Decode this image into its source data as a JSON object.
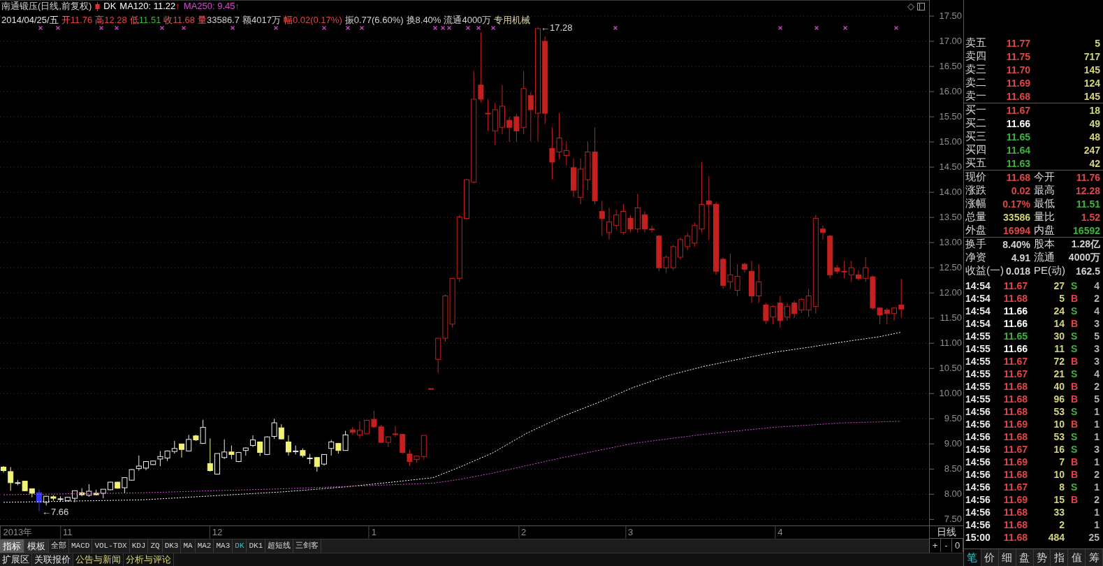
{
  "chart_header": {
    "title": "南通锻压(日线,前复权)",
    "indicator": "DK",
    "averages": [
      {
        "label": "MA120: 11.22",
        "arrow": "↑",
        "color": "#ffffff"
      },
      {
        "label": "MA250: 9.45",
        "arrow": "↑",
        "color": "#d24ad2"
      }
    ],
    "date": "2014/04/25/五",
    "fields": [
      {
        "label": {
          "text": "开",
          "kind": "up"
        },
        "value": {
          "text": "11.76",
          "kind": "up"
        }
      },
      {
        "label": {
          "text": "高",
          "kind": "up"
        },
        "value": {
          "text": "12.28",
          "kind": "up"
        }
      },
      {
        "label": {
          "text": "低",
          "kind": "up"
        },
        "value": {
          "text": "11.51",
          "kind": "down"
        }
      },
      {
        "label": {
          "text": "收",
          "kind": "up"
        },
        "value": {
          "text": "11.68",
          "kind": "up"
        }
      },
      {
        "label": {
          "text": "量",
          "kind": "up"
        },
        "value": {
          "text": "33586.7",
          "kind": "plain"
        }
      },
      {
        "label": {
          "text": "额",
          "kind": "plain"
        },
        "value": {
          "text": "4017万",
          "kind": "plain"
        }
      },
      {
        "label": {
          "text": "幅",
          "kind": "up"
        },
        "value": {
          "text": "0.02(0.17%)",
          "kind": "up"
        }
      },
      {
        "label": {
          "text": "振",
          "kind": "plain"
        },
        "value": {
          "text": "0.77(6.60%)",
          "kind": "plain"
        }
      },
      {
        "label": {
          "text": "换",
          "kind": "plain"
        },
        "value": {
          "text": "8.40%",
          "kind": "plain"
        }
      },
      {
        "label": {
          "text": "流通",
          "kind": "plain"
        },
        "value": {
          "text": "4000万",
          "kind": "plain"
        }
      }
    ],
    "sector": "专用机械"
  },
  "chart": {
    "chart_data": {
      "type": "candlestick",
      "categories": [
        null,
        null,
        "2013年",
        null,
        null,
        null,
        null,
        null,
        null,
        "11",
        null,
        null,
        null,
        null,
        null,
        null,
        null,
        null,
        null,
        null,
        null,
        null,
        null,
        null,
        null,
        null,
        null,
        null,
        null,
        null,
        "12",
        null,
        null,
        null,
        null,
        null,
        null,
        null,
        null,
        null,
        null,
        null,
        null,
        null,
        null,
        null,
        null,
        null,
        null,
        null,
        null,
        null,
        "1",
        null,
        null,
        null,
        null,
        null,
        null,
        null,
        null,
        null,
        null,
        null,
        null,
        null,
        null,
        null,
        null,
        null,
        null,
        null,
        null,
        "2",
        null,
        null,
        null,
        null,
        null,
        null,
        null,
        null,
        null,
        null,
        null,
        null,
        null,
        null,
        "3",
        null,
        null,
        null,
        null,
        null,
        null,
        null,
        null,
        null,
        null,
        null,
        null,
        null,
        null,
        null,
        null,
        null,
        null,
        null,
        null,
        "4",
        null,
        null,
        null,
        null,
        null,
        null,
        null,
        null,
        null,
        null,
        null,
        null,
        null,
        null,
        null,
        null,
        null
      ],
      "ohlc": [
        [
          8.54,
          8.56,
          8.43,
          8.47
        ],
        [
          8.45,
          8.54,
          8.07,
          8.23
        ],
        [
          8.22,
          8.28,
          8.18,
          8.23
        ],
        [
          8.26,
          8.27,
          8.06,
          8.07
        ],
        [
          8.11,
          8.11,
          7.94,
          8.02
        ],
        [
          8.03,
          8.09,
          7.66,
          7.84
        ],
        [
          7.84,
          7.97,
          7.78,
          7.96
        ],
        [
          7.95,
          7.98,
          7.87,
          7.92
        ],
        [
          7.9,
          7.96,
          7.85,
          7.91
        ],
        [
          7.87,
          7.95,
          7.86,
          7.94
        ],
        [
          7.92,
          8.07,
          7.84,
          8.07
        ],
        [
          8.03,
          8.12,
          7.96,
          7.99
        ],
        [
          7.98,
          8.2,
          7.95,
          8.06
        ],
        [
          8.02,
          8.09,
          7.98,
          7.99
        ],
        [
          8.02,
          8.1,
          7.92,
          8.1
        ],
        [
          8.09,
          8.25,
          8.08,
          8.24
        ],
        [
          8.24,
          8.25,
          8.11,
          8.12
        ],
        [
          8.13,
          8.33,
          8.02,
          8.33
        ],
        [
          8.28,
          8.5,
          8.27,
          8.49
        ],
        [
          8.51,
          8.77,
          8.47,
          8.56
        ],
        [
          8.52,
          8.65,
          8.48,
          8.65
        ],
        [
          8.59,
          8.67,
          8.58,
          8.66
        ],
        [
          8.7,
          8.86,
          8.56,
          8.75
        ],
        [
          8.72,
          8.87,
          8.66,
          8.86
        ],
        [
          8.85,
          9.06,
          8.81,
          8.91
        ],
        [
          9.0,
          9.0,
          8.73,
          8.89
        ],
        [
          8.86,
          9.18,
          8.85,
          9.09
        ],
        [
          9.16,
          9.18,
          9.06,
          9.08
        ],
        [
          9.01,
          9.48,
          9.01,
          9.33
        ],
        [
          8.61,
          9.11,
          8.45,
          8.47
        ],
        [
          8.4,
          8.81,
          8.4,
          8.81
        ],
        [
          8.73,
          9.09,
          8.7,
          8.84
        ],
        [
          8.84,
          8.97,
          8.7,
          8.79
        ],
        [
          8.65,
          8.84,
          8.64,
          8.83
        ],
        [
          8.87,
          8.93,
          8.77,
          8.92
        ],
        [
          8.97,
          9.17,
          8.94,
          9.08
        ],
        [
          9.04,
          9.05,
          8.76,
          8.83
        ],
        [
          8.79,
          9.15,
          8.78,
          9.14
        ],
        [
          9.15,
          9.5,
          9.1,
          9.42
        ],
        [
          9.32,
          9.39,
          9.09,
          9.1
        ],
        [
          9.04,
          9.17,
          8.77,
          8.84
        ],
        [
          8.85,
          8.97,
          8.79,
          8.86
        ],
        [
          8.87,
          8.91,
          8.73,
          8.77
        ],
        [
          8.71,
          8.8,
          8.6,
          8.72
        ],
        [
          8.73,
          8.74,
          8.45,
          8.55
        ],
        [
          8.6,
          8.79,
          8.57,
          8.79
        ],
        [
          8.91,
          9.08,
          8.77,
          9.04
        ],
        [
          9.01,
          9.02,
          8.81,
          8.87
        ],
        [
          8.87,
          9.26,
          8.87,
          9.18
        ],
        [
          9.28,
          9.34,
          9.18,
          9.23
        ],
        [
          9.18,
          9.45,
          9.11,
          9.27
        ],
        [
          9.2,
          9.48,
          9.19,
          9.47
        ],
        [
          9.49,
          9.66,
          9.32,
          9.34
        ],
        [
          9.34,
          9.38,
          9.02,
          9.03
        ],
        [
          9.03,
          9.15,
          8.94,
          9.14
        ],
        [
          9.2,
          9.36,
          9.14,
          9.19
        ],
        [
          9.19,
          9.2,
          8.8,
          8.83
        ],
        [
          8.8,
          8.89,
          8.56,
          8.65
        ],
        [
          8.69,
          8.77,
          8.63,
          8.76
        ],
        [
          8.75,
          9.17,
          8.69,
          9.17
        ],
        [
          10.1,
          10.1,
          10.1,
          10.1
        ],
        [
          10.68,
          11.1,
          10.41,
          11.1
        ],
        [
          11.1,
          11.97,
          11.03,
          11.94
        ],
        [
          11.38,
          12.29,
          11.31,
          12.29
        ],
        [
          12.29,
          13.55,
          12.22,
          13.51
        ],
        [
          13.48,
          14.27,
          13.45,
          14.25
        ],
        [
          14.2,
          16.41,
          14.18,
          15.85
        ],
        [
          16.13,
          17.18,
          15.78,
          15.85
        ],
        [
          15.57,
          15.85,
          15.22,
          15.57
        ],
        [
          15.22,
          15.78,
          14.94,
          15.64
        ],
        [
          15.29,
          16.13,
          15.15,
          15.71
        ],
        [
          15.43,
          15.5,
          15.0,
          15.29
        ],
        [
          15.5,
          15.55,
          15.0,
          15.22
        ],
        [
          15.29,
          16.41,
          15.15,
          16.06
        ],
        [
          15.92,
          15.99,
          15.01,
          15.64
        ],
        [
          15.57,
          17.28,
          15.01,
          17.25
        ],
        [
          17.0,
          17.1,
          15.36,
          15.57
        ],
        [
          14.87,
          15.29,
          14.25,
          14.6
        ],
        [
          14.8,
          15.57,
          14.66,
          15.08
        ],
        [
          14.73,
          15.01,
          14.53,
          14.83
        ],
        [
          14.49,
          14.67,
          13.9,
          14.04
        ],
        [
          13.9,
          14.67,
          13.76,
          14.46
        ],
        [
          14.25,
          15.01,
          14.04,
          14.8
        ],
        [
          14.8,
          15.29,
          13.76,
          13.83
        ],
        [
          13.62,
          13.83,
          13.13,
          13.48
        ],
        [
          13.2,
          13.69,
          13.06,
          13.41
        ],
        [
          13.34,
          13.65,
          13.27,
          13.55
        ],
        [
          13.2,
          13.76,
          13.15,
          13.62
        ],
        [
          13.48,
          13.55,
          13.2,
          13.27
        ],
        [
          13.27,
          13.97,
          13.2,
          13.69
        ],
        [
          13.55,
          13.62,
          13.2,
          13.27
        ],
        [
          13.27,
          13.34,
          13.2,
          13.27
        ],
        [
          13.13,
          13.15,
          12.43,
          12.5
        ],
        [
          12.5,
          12.75,
          12.4,
          12.71
        ],
        [
          12.5,
          12.95,
          12.45,
          12.92
        ],
        [
          12.71,
          13.1,
          12.66,
          13.06
        ],
        [
          12.92,
          13.2,
          12.85,
          13.13
        ],
        [
          12.99,
          13.4,
          12.92,
          13.34
        ],
        [
          13.27,
          14.6,
          13.2,
          13.76
        ],
        [
          13.83,
          14.32,
          13.06,
          13.76
        ],
        [
          13.76,
          13.8,
          12.36,
          12.43
        ],
        [
          12.67,
          12.7,
          12.08,
          12.15
        ],
        [
          12.22,
          12.78,
          12.08,
          12.36
        ],
        [
          12.05,
          12.57,
          11.94,
          12.33
        ],
        [
          12.57,
          12.6,
          12.4,
          12.47
        ],
        [
          12.43,
          12.64,
          11.8,
          11.94
        ],
        [
          11.94,
          12.57,
          11.8,
          12.22
        ],
        [
          11.76,
          11.8,
          11.38,
          11.45
        ],
        [
          11.52,
          11.76,
          11.38,
          11.73
        ],
        [
          11.8,
          11.94,
          11.31,
          11.45
        ],
        [
          11.52,
          11.8,
          11.45,
          11.73
        ],
        [
          11.8,
          11.85,
          11.5,
          11.59
        ],
        [
          11.66,
          11.9,
          11.6,
          11.87
        ],
        [
          11.66,
          12.08,
          11.52,
          11.94
        ],
        [
          11.73,
          13.55,
          11.59,
          13.48
        ],
        [
          13.27,
          13.34,
          13.06,
          13.2
        ],
        [
          13.13,
          13.15,
          12.29,
          12.36
        ],
        [
          12.5,
          12.55,
          12.38,
          12.43
        ],
        [
          12.43,
          12.64,
          12.29,
          12.43
        ],
        [
          12.36,
          12.64,
          12.22,
          12.5
        ],
        [
          12.36,
          12.45,
          12.25,
          12.29
        ],
        [
          12.29,
          12.71,
          12.22,
          12.5
        ],
        [
          12.32,
          12.35,
          11.66,
          11.7
        ],
        [
          11.7,
          11.72,
          11.38,
          11.56
        ],
        [
          11.66,
          11.7,
          11.38,
          11.59
        ],
        [
          11.59,
          11.72,
          11.45,
          11.7
        ],
        [
          11.76,
          12.28,
          11.51,
          11.68
        ]
      ],
      "colors": [
        "#f2f27a",
        "#f2f27a",
        "#ececec",
        "#f2f27a",
        "#f2f27a",
        "#3434ff",
        "#ececec",
        "#f2f27a",
        "#ececec",
        "#ececec",
        "#ececec",
        "#f2f27a",
        "#ececec",
        "#f2f27a",
        "#ececec",
        "#ececec",
        "#f2f27a",
        "#ececec",
        "#ececec",
        "#ececec",
        "#ececec",
        "#ececec",
        "#ececec",
        "#ececec",
        "#ececec",
        "#f2f27a",
        "#ececec",
        "#f2f27a",
        "#ececec",
        "#f2f27a",
        "#ececec",
        "#ececec",
        "#f2f27a",
        "#ececec",
        "#ececec",
        "#ececec",
        "#f2f27a",
        "#ececec",
        "#ececec",
        "#f2f27a",
        "#f2f27a",
        "#ececec",
        "#f2f27a",
        "#ececec",
        "#f2f27a",
        "#ececec",
        "#ececec",
        "#f2f27a",
        "#ececec",
        "#c42020",
        "#c42020",
        "#c42020",
        "#c42020",
        "#c42020",
        "#c42020",
        "#c42020",
        "#c42020",
        "#c42020",
        "#c42020",
        "#c42020",
        "#c42020",
        "#c42020",
        "#c42020",
        "#c42020",
        "#c42020",
        "#c42020",
        "#c42020",
        "#c42020",
        "#c42020",
        "#c42020",
        "#c42020",
        "#c42020",
        "#c42020",
        "#c42020",
        "#c42020",
        "#c42020",
        "#c42020",
        "#c42020",
        "#c42020",
        "#c42020",
        "#c42020",
        "#c42020",
        "#c42020",
        "#c42020",
        "#c42020",
        "#c42020",
        "#c42020",
        "#c42020",
        "#c42020",
        "#c42020",
        "#c42020",
        "#c42020",
        "#c42020",
        "#c42020",
        "#c42020",
        "#c42020",
        "#c42020",
        "#c42020",
        "#c42020",
        "#c42020",
        "#c42020",
        "#c42020",
        "#c42020",
        "#c42020",
        "#c42020",
        "#c42020",
        "#c42020",
        "#c42020",
        "#c42020",
        "#c42020",
        "#c42020",
        "#c42020",
        "#c42020",
        "#c42020",
        "#c42020",
        "#c42020",
        "#c42020",
        "#c42020",
        "#c42020",
        "#c42020",
        "#c42020",
        "#c42020",
        "#c42020",
        "#c42020",
        "#c42020",
        "#c42020",
        "#c42020"
      ],
      "ylim": [
        7.38,
        17.82
      ],
      "yticks": [
        {
          "value": 17.5,
          "label": "17.50"
        },
        {
          "value": 17.0,
          "label": "17.00"
        },
        {
          "value": 16.5,
          "label": "16.50"
        },
        {
          "value": 16.0,
          "label": "16.00"
        },
        {
          "value": 15.5,
          "label": "15.50"
        },
        {
          "value": 15.0,
          "label": "15.00"
        },
        {
          "value": 14.5,
          "label": "14.50"
        },
        {
          "value": 14.0,
          "label": "14.00"
        },
        {
          "value": 13.5,
          "label": "13.50"
        },
        {
          "value": 13.0,
          "label": "13.00"
        },
        {
          "value": 12.5,
          "label": "12.50"
        },
        {
          "value": 12.0,
          "label": "12.00"
        },
        {
          "value": 11.5,
          "label": "11.50"
        },
        {
          "value": 11.0,
          "label": "11.00"
        },
        {
          "value": 10.5,
          "label": "10.50"
        },
        {
          "value": 10.0,
          "label": "10.00"
        },
        {
          "value": 9.5,
          "label": "9.50"
        },
        {
          "value": 9.0,
          "label": "9.00"
        },
        {
          "value": 8.5,
          "label": "8.50"
        },
        {
          "value": 8.0,
          "label": "8.00"
        },
        {
          "value": 7.5,
          "label": "7.50"
        }
      ],
      "grid": true,
      "annotations": [
        "←17.28",
        "←7.66"
      ]
    },
    "period": "日线",
    "zoom_buttons": [
      "+",
      "-",
      "0"
    ]
  },
  "indicator_bar": {
    "modes": [
      {
        "label": "指标",
        "selected": true
      },
      {
        "label": "模板",
        "selected": false
      }
    ],
    "indicators": [
      {
        "label": "全部",
        "selected": false
      },
      {
        "label": "MACD",
        "selected": false
      },
      {
        "label": "VOL-TDX",
        "selected": false
      },
      {
        "label": "KDJ",
        "selected": false
      },
      {
        "label": "ZQ",
        "selected": false
      },
      {
        "label": "DK3",
        "selected": false
      },
      {
        "label": "MA",
        "selected": false
      },
      {
        "label": "MA2",
        "selected": false
      },
      {
        "label": "MA3",
        "selected": false
      },
      {
        "label": "DK",
        "selected": true
      },
      {
        "label": "DK1",
        "selected": false
      },
      {
        "label": "超短线",
        "selected": false
      },
      {
        "label": "三剑客",
        "selected": false
      }
    ]
  },
  "extension_bar": [
    {
      "label": "扩展区",
      "kind": "tab"
    },
    {
      "label": "关联报价",
      "kind": "tab"
    },
    {
      "label": "公告与新闻",
      "kind": "link"
    },
    {
      "label": "分析与评论",
      "kind": "link"
    }
  ],
  "quote_panel": {
    "asks": [
      {
        "label": "卖五",
        "price": "11.77",
        "kind": "up",
        "volume": "5"
      },
      {
        "label": "卖四",
        "price": "11.75",
        "kind": "up",
        "volume": "717"
      },
      {
        "label": "卖三",
        "price": "11.70",
        "kind": "up",
        "volume": "145"
      },
      {
        "label": "卖二",
        "price": "11.69",
        "kind": "up",
        "volume": "124"
      },
      {
        "label": "卖一",
        "price": "11.68",
        "kind": "up",
        "volume": "145"
      }
    ],
    "bids": [
      {
        "label": "买一",
        "price": "11.67",
        "kind": "up",
        "volume": "18"
      },
      {
        "label": "买二",
        "price": "11.66",
        "kind": "flat",
        "volume": "49"
      },
      {
        "label": "买三",
        "price": "11.65",
        "kind": "down",
        "volume": "48"
      },
      {
        "label": "买四",
        "price": "11.64",
        "kind": "down",
        "volume": "247"
      },
      {
        "label": "买五",
        "price": "11.63",
        "kind": "down",
        "volume": "42"
      }
    ],
    "stats": [
      {
        "label": "现价",
        "value": "11.68",
        "kind": "up"
      },
      {
        "label": "今开",
        "value": "11.76",
        "kind": "up"
      },
      {
        "label": "涨跌",
        "value": "0.02",
        "kind": "up"
      },
      {
        "label": "最高",
        "value": "12.28",
        "kind": "up"
      },
      {
        "label": "涨幅",
        "value": "0.17%",
        "kind": "up"
      },
      {
        "label": "最低",
        "value": "11.51",
        "kind": "down"
      },
      {
        "label": "总量",
        "value": "33586",
        "kind": "volume"
      },
      {
        "label": "量比",
        "value": "1.52",
        "kind": "up"
      },
      {
        "label": "外盘",
        "value": "16994",
        "kind": "up"
      },
      {
        "label": "内盘",
        "value": "16592",
        "kind": "down"
      }
    ],
    "fundamentals": [
      {
        "label": "换手",
        "value": "8.40%",
        "kind": "plain"
      },
      {
        "label": "股本",
        "value": "1.28亿",
        "kind": "plain"
      },
      {
        "label": "净资",
        "value": "4.91",
        "kind": "plain"
      },
      {
        "label": "流通",
        "value": "4000万",
        "kind": "plain"
      },
      {
        "label": "收益(一)",
        "value": "0.018",
        "kind": "plain"
      },
      {
        "label": "PE(动)",
        "value": "162.5",
        "kind": "plain"
      }
    ],
    "trades": [
      {
        "time": "14:54",
        "price": "11.67",
        "kind": "up",
        "volume": "27",
        "side": {
          "label": "S",
          "kind": "sell"
        },
        "count": "4"
      },
      {
        "time": "14:54",
        "price": "11.68",
        "kind": "up",
        "volume": "5",
        "side": {
          "label": "B",
          "kind": "buy"
        },
        "count": "2"
      },
      {
        "time": "14:54",
        "price": "11.66",
        "kind": "flat",
        "volume": "24",
        "side": {
          "label": "S",
          "kind": "sell"
        },
        "count": "4"
      },
      {
        "time": "14:54",
        "price": "11.66",
        "kind": "flat",
        "volume": "14",
        "side": {
          "label": "B",
          "kind": "buy"
        },
        "count": "3"
      },
      {
        "time": "14:55",
        "price": "11.65",
        "kind": "down",
        "volume": "30",
        "side": {
          "label": "S",
          "kind": "sell"
        },
        "count": "5"
      },
      {
        "time": "14:55",
        "price": "11.66",
        "kind": "flat",
        "volume": "11",
        "side": {
          "label": "S",
          "kind": "sell"
        },
        "count": "3"
      },
      {
        "time": "14:55",
        "price": "11.67",
        "kind": "up",
        "volume": "72",
        "side": {
          "label": "B",
          "kind": "buy"
        },
        "count": "3"
      },
      {
        "time": "14:55",
        "price": "11.67",
        "kind": "up",
        "volume": "21",
        "side": {
          "label": "S",
          "kind": "sell"
        },
        "count": "4"
      },
      {
        "time": "14:55",
        "price": "11.68",
        "kind": "up",
        "volume": "40",
        "side": {
          "label": "B",
          "kind": "buy"
        },
        "count": "2"
      },
      {
        "time": "14:55",
        "price": "11.68",
        "kind": "up",
        "volume": "96",
        "side": {
          "label": "B",
          "kind": "buy"
        },
        "count": "5"
      },
      {
        "time": "14:56",
        "price": "11.68",
        "kind": "up",
        "volume": "53",
        "side": {
          "label": "S",
          "kind": "sell"
        },
        "count": "1"
      },
      {
        "time": "14:56",
        "price": "11.69",
        "kind": "up",
        "volume": "10",
        "side": {
          "label": "B",
          "kind": "buy"
        },
        "count": "1"
      },
      {
        "time": "14:56",
        "price": "11.68",
        "kind": "up",
        "volume": "53",
        "side": {
          "label": "S",
          "kind": "sell"
        },
        "count": "1"
      },
      {
        "time": "14:56",
        "price": "11.67",
        "kind": "up",
        "volume": "16",
        "side": {
          "label": "S",
          "kind": "sell"
        },
        "count": "3"
      },
      {
        "time": "14:56",
        "price": "11.69",
        "kind": "up",
        "volume": "7",
        "side": {
          "label": "B",
          "kind": "buy"
        },
        "count": "1"
      },
      {
        "time": "14:56",
        "price": "11.68",
        "kind": "up",
        "volume": "10",
        "side": {
          "label": "B",
          "kind": "buy"
        },
        "count": "2"
      },
      {
        "time": "14:56",
        "price": "11.67",
        "kind": "up",
        "volume": "8",
        "side": {
          "label": "S",
          "kind": "sell"
        },
        "count": "1"
      },
      {
        "time": "14:56",
        "price": "11.69",
        "kind": "up",
        "volume": "15",
        "side": {
          "label": "B",
          "kind": "buy"
        },
        "count": "2"
      },
      {
        "time": "14:56",
        "price": "11.68",
        "kind": "up",
        "volume": "33",
        "count": "1"
      },
      {
        "time": "14:56",
        "price": "11.68",
        "kind": "up",
        "volume": "2",
        "count": "1"
      },
      {
        "time": "15:00",
        "price": "11.68",
        "kind": "up",
        "volume": "484",
        "count": "25"
      }
    ],
    "tabs": [
      {
        "label": "笔",
        "selected": true
      },
      {
        "label": "价",
        "selected": false
      },
      {
        "label": "细",
        "selected": false
      },
      {
        "label": "盘",
        "selected": false
      },
      {
        "label": "势",
        "selected": false
      },
      {
        "label": "指",
        "selected": false
      },
      {
        "label": "值",
        "selected": false
      },
      {
        "label": "筹",
        "selected": false
      }
    ]
  }
}
